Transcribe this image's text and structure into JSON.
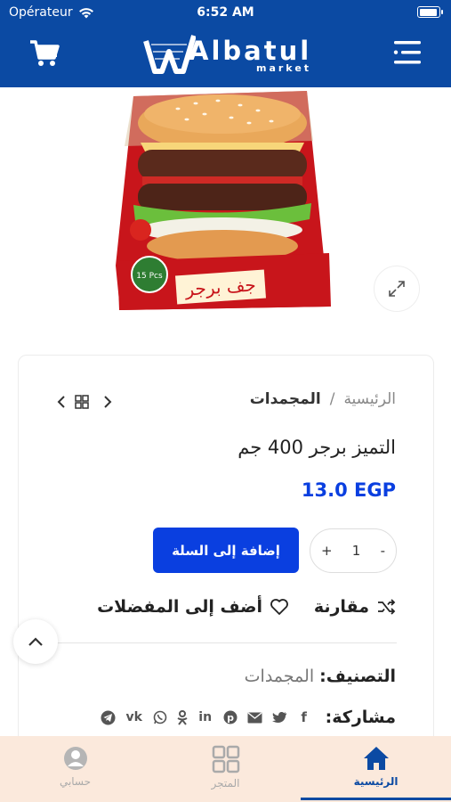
{
  "status_bar": {
    "carrier": "Opérateur",
    "time": "6:52 AM",
    "battery": 0.92
  },
  "header": {
    "logo_text": "Albatul",
    "logo_sub": "market",
    "background_color": "#0b4aa3"
  },
  "breadcrumb": {
    "home": "الرئيسية",
    "separator": "/",
    "current": "المجمدات"
  },
  "product": {
    "title": "التميز برجر 400 جم",
    "price": "13.0 EGP",
    "quantity": "1",
    "qty_minus": "-",
    "qty_plus": "+",
    "add_to_cart": "إضافة إلى السلة",
    "compare": "مقارنة",
    "wishlist": "أضف إلى المفضلات",
    "category_label": "التصنيف:",
    "category_value": "المجمدات",
    "share_label": "مشاركة:",
    "share_icons": [
      "facebook-icon",
      "twitter-icon",
      "email-icon",
      "pinterest-icon",
      "linkedin-icon",
      "odnoklassniki-icon",
      "whatsapp-icon",
      "vk-icon",
      "telegram-icon"
    ]
  },
  "bottom_nav": {
    "tabs": [
      {
        "label": "الرئيسية",
        "icon": "home-icon",
        "active": true
      },
      {
        "label": "المتجر",
        "icon": "grid-icon",
        "active": false
      },
      {
        "label": "حسابي",
        "icon": "account-icon",
        "active": false
      }
    ]
  },
  "colors": {
    "primary": "#0b4aa3",
    "accent": "#0a3fe0",
    "nav_bg": "#fbe9dc"
  }
}
